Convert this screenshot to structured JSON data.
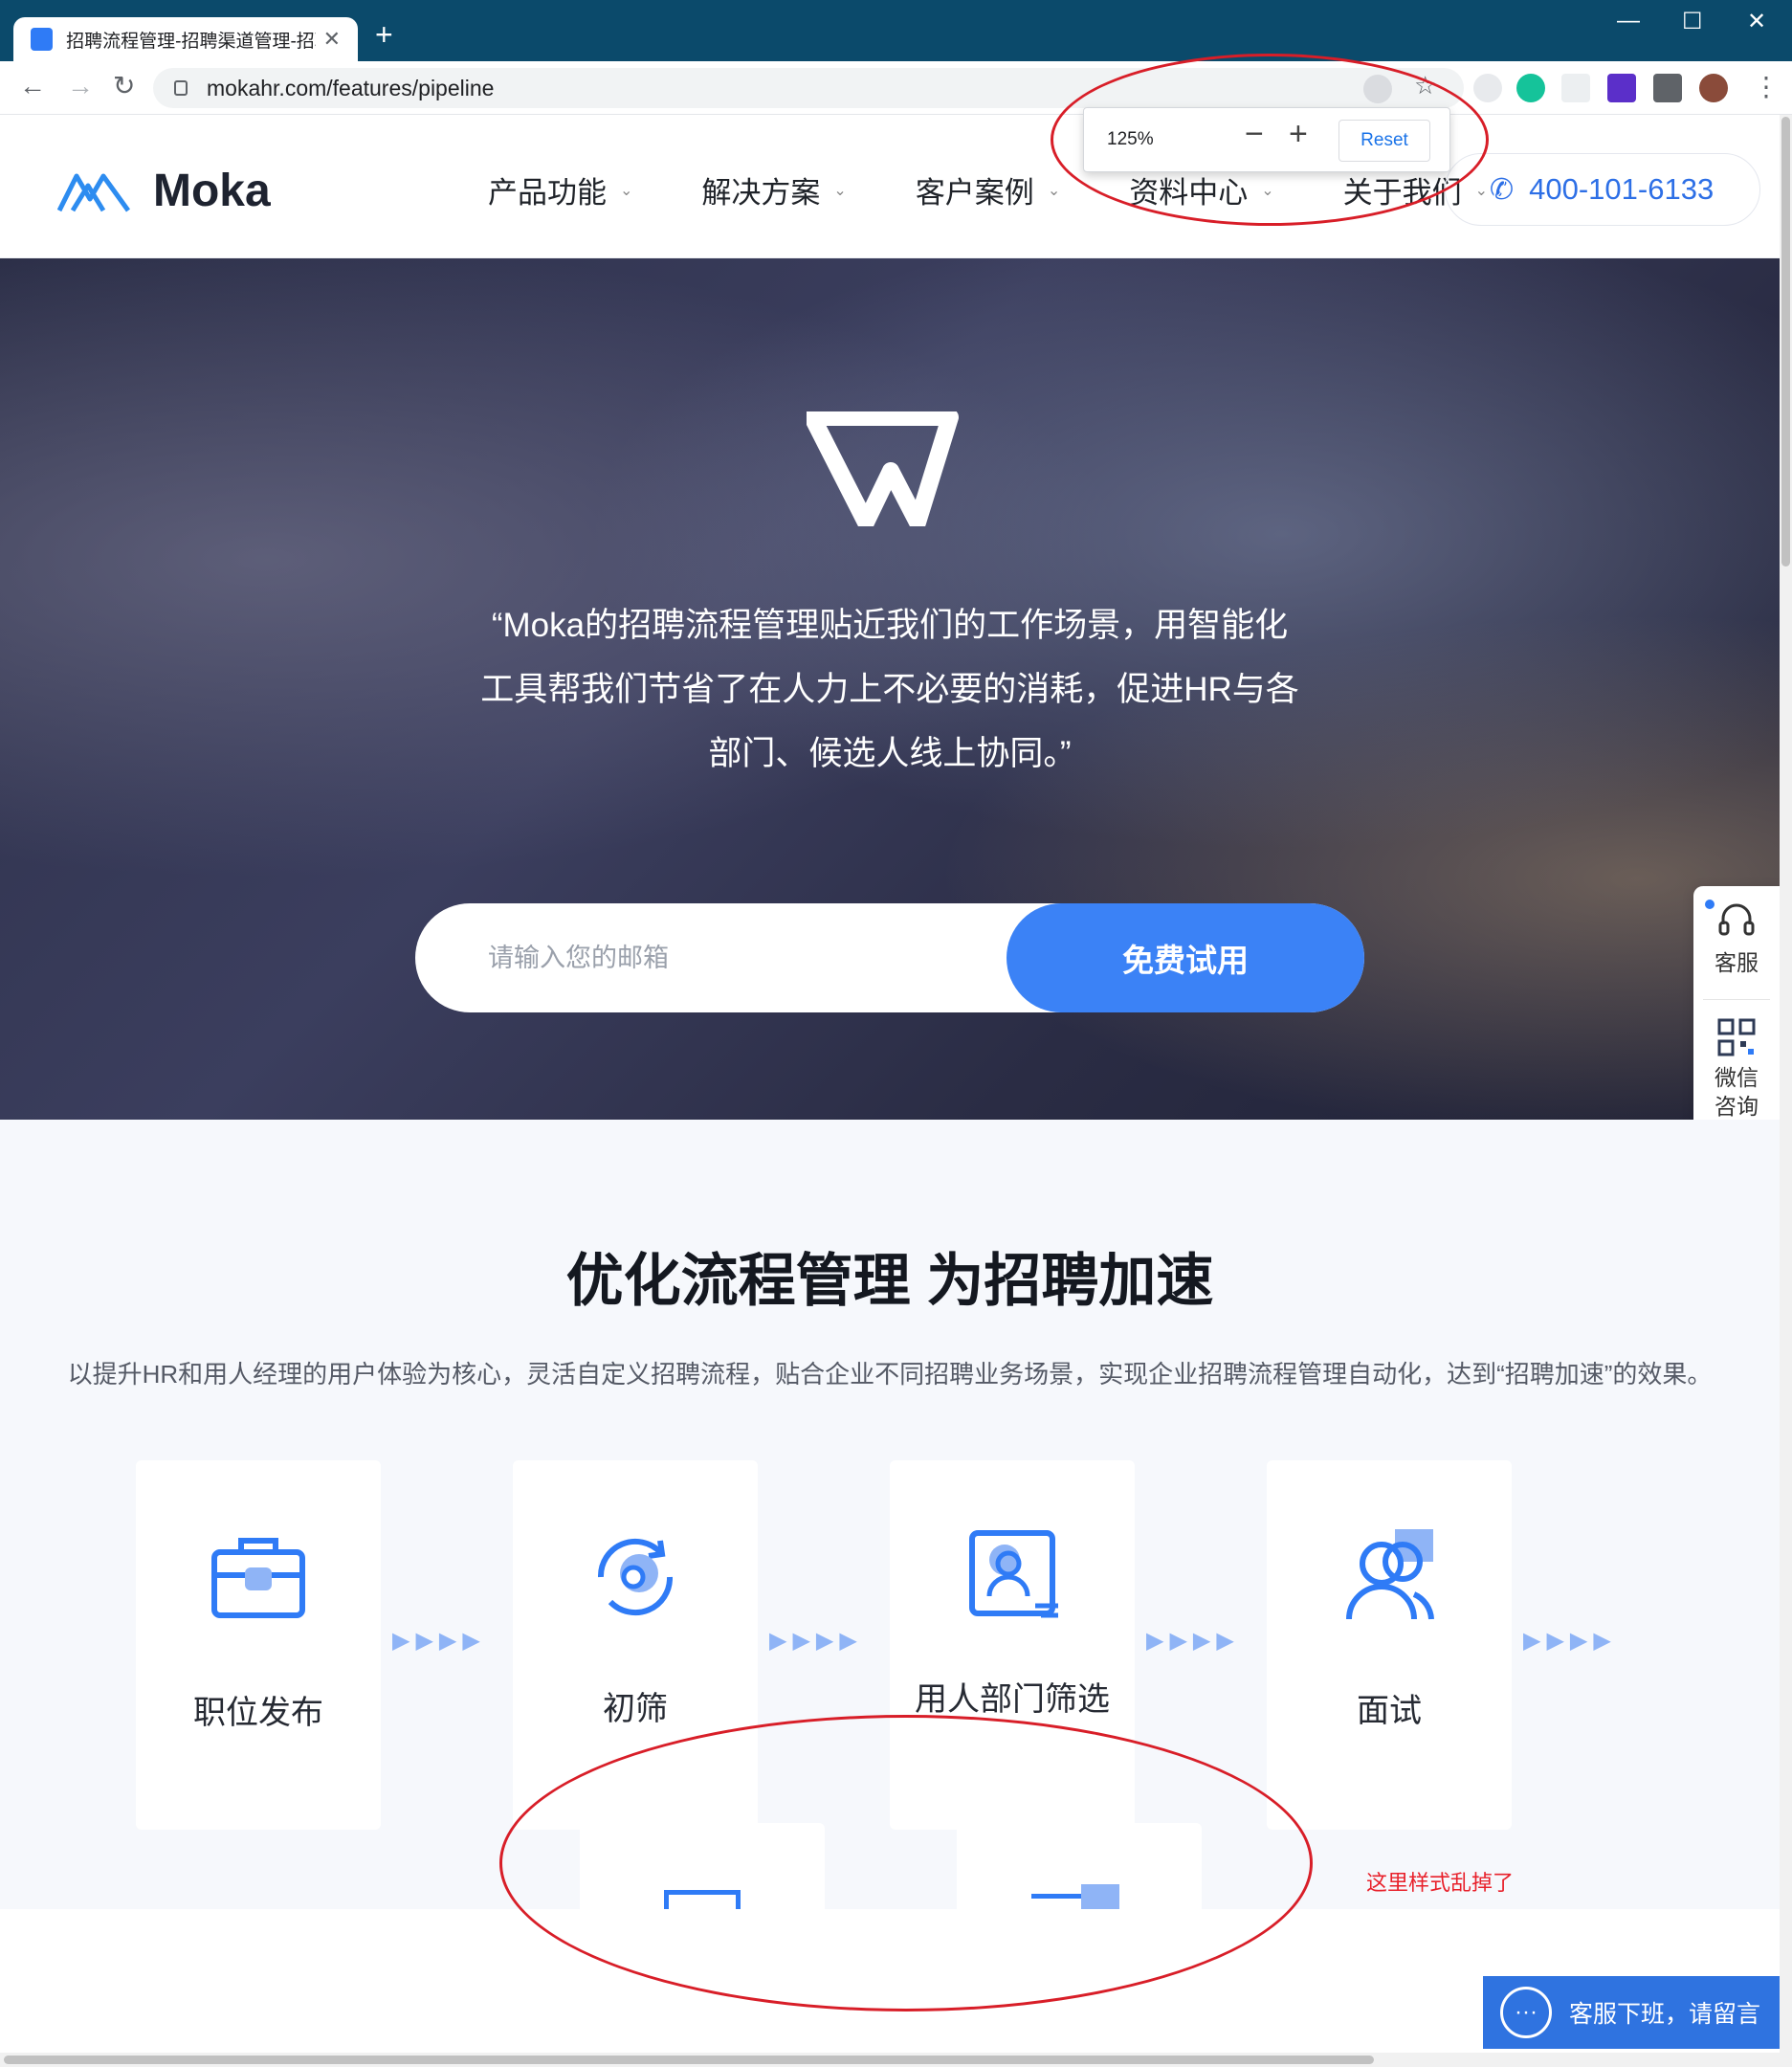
{
  "browser": {
    "tab_title": "招聘流程管理-招聘渠道管理-招聘",
    "url": "mokahr.com/features/pipeline",
    "zoom": {
      "value": "125%",
      "minus": "−",
      "plus": "+",
      "reset": "Reset"
    },
    "window_controls": [
      "—",
      "☐",
      "✕"
    ]
  },
  "header": {
    "logo_text": "Moka",
    "nav": [
      {
        "label": "产品功能"
      },
      {
        "label": "解决方案"
      },
      {
        "label": "客户案例"
      },
      {
        "label": "资料中心"
      },
      {
        "label": "关于我们"
      }
    ],
    "phone": "400-101-6133"
  },
  "hero": {
    "quote_lines": [
      "“Moka的招聘流程管理贴近我们的工作场景，用智能化",
      "工具帮我们节省了在人力上不必要的消耗，促进HR与各",
      "部门、候选人线上协同。”"
    ],
    "email_placeholder": "请输入您的邮箱",
    "trial_button": "免费试用"
  },
  "side_float": {
    "service": "客服",
    "wechat_line1": "微信",
    "wechat_line2": "咨询"
  },
  "features": {
    "title": "优化流程管理 为招聘加速",
    "description": "以提升HR和用人经理的用户体验为核心，灵活自定义招聘流程，贴合企业不同招聘业务场景，实现企业招聘流程管理自动化，达到“招聘加速”的效果。",
    "steps": [
      {
        "label": "职位发布",
        "icon": "briefcase-icon"
      },
      {
        "label": "初筛",
        "icon": "refresh-screening-icon"
      },
      {
        "label": "用人部门筛选",
        "icon": "profile-card-icon"
      },
      {
        "label": "面试",
        "icon": "people-icon"
      }
    ],
    "arrows": "▶▶▶▶"
  },
  "annotation": {
    "note": "这里样式乱掉了"
  },
  "chat": {
    "label": "客服下班，请留言"
  },
  "colors": {
    "brand_blue": "#3b82f6",
    "titlebar": "#0b4a6b",
    "annotation_red": "#d81e28"
  }
}
